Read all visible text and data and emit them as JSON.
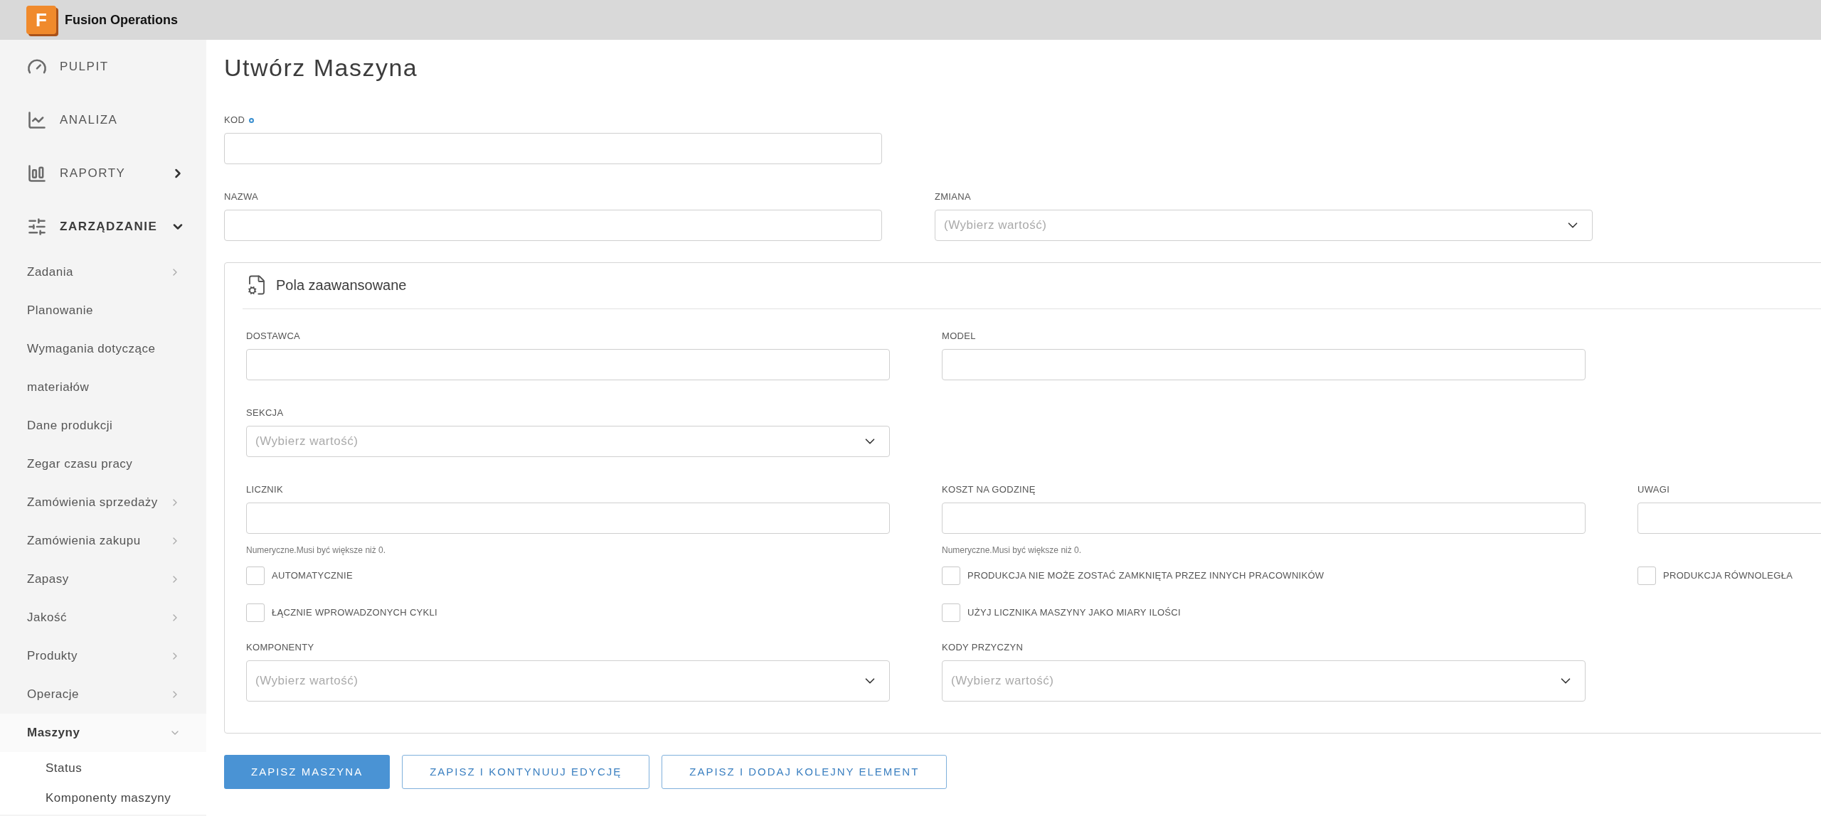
{
  "header": {
    "logo_letter": "F",
    "app_name": "Fusion Operations"
  },
  "sidebar": {
    "items": [
      {
        "label": "PULPIT"
      },
      {
        "label": "ANALIZA"
      },
      {
        "label": "RAPORTY",
        "expanded": false
      },
      {
        "label": "ZARZĄDZANIE",
        "expanded": true,
        "children": [
          {
            "label": "Zadania",
            "expanded": false
          },
          {
            "label": "Planowanie"
          },
          {
            "label": "Wymagania dotyczące materiałów"
          },
          {
            "label": "Dane produkcji"
          },
          {
            "label": "Zegar czasu pracy"
          },
          {
            "label": "Zamówienia sprzedaży",
            "expanded": false
          },
          {
            "label": "Zamówienia zakupu",
            "expanded": false
          },
          {
            "label": "Zapasy",
            "expanded": false
          },
          {
            "label": "Jakość",
            "expanded": false
          },
          {
            "label": "Produkty",
            "expanded": false
          },
          {
            "label": "Operacje",
            "expanded": false
          },
          {
            "label": "Maszyny",
            "expanded": true,
            "children": [
              {
                "label": "Status"
              },
              {
                "label": "Komponenty maszyny"
              }
            ]
          }
        ]
      }
    ]
  },
  "title": "Utwórz Maszyna",
  "form_rows": [
    [
      {
        "kind": "text",
        "label": "KOD",
        "required": true
      }
    ],
    [
      {
        "kind": "text",
        "label": "NAZWA",
        "required": false
      },
      {
        "kind": "select",
        "label": "ZMIANA",
        "placeholder": "(Wybierz wartość)",
        "required": false
      }
    ]
  ],
  "advanced": {
    "title": "Pola zaawansowane",
    "rows": [
      [
        {
          "kind": "text",
          "label": "DOSTAWCA"
        },
        {
          "kind": "text",
          "label": "MODEL"
        }
      ],
      [
        {
          "kind": "select",
          "label": "SEKCJA",
          "placeholder": "(Wybierz wartość)"
        }
      ],
      [
        {
          "kind": "text",
          "label": "LICZNIK",
          "hint": "Numeryczne.Musi być większe niż 0."
        },
        {
          "kind": "text",
          "label": "KOSZT NA GODZINĘ",
          "hint": "Numeryczne.Musi być większe niż 0."
        },
        {
          "kind": "text",
          "label": "UWAGI"
        }
      ],
      [
        {
          "kind": "checkbox",
          "label": "AUTOMATYCZNIE",
          "checked": false
        },
        {
          "kind": "checkbox",
          "label": "PRODUKCJA NIE MOŻE ZOSTAĆ ZAMKNIĘTA PRZEZ INNYCH PRACOWNIKÓW",
          "checked": false
        },
        {
          "kind": "checkbox",
          "label": "PRODUKCJA RÓWNOLEGŁA",
          "checked": false
        }
      ],
      [
        {
          "kind": "checkbox",
          "label": "ŁĄCZNIE WPROWADZONYCH CYKLI",
          "checked": false
        },
        {
          "kind": "checkbox",
          "label": "UŻYJ LICZNIKA MASZYNY JAKO MIARY ILOŚCI",
          "checked": false
        }
      ],
      [
        {
          "kind": "bigselect",
          "label": "KOMPONENTY",
          "placeholder": "(Wybierz wartość)"
        },
        {
          "kind": "bigselect",
          "label": "KODY PRZYCZYN",
          "placeholder": "(Wybierz wartość)"
        }
      ]
    ]
  },
  "buttons": [
    {
      "label": "ZAPISZ MASZYNA",
      "kind": "primary"
    },
    {
      "label": "ZAPISZ I KONTYNUUJ EDYCJĘ",
      "kind": "outline"
    },
    {
      "label": "ZAPISZ I DODAJ KOLEJNY ELEMENT",
      "kind": "outline"
    }
  ]
}
